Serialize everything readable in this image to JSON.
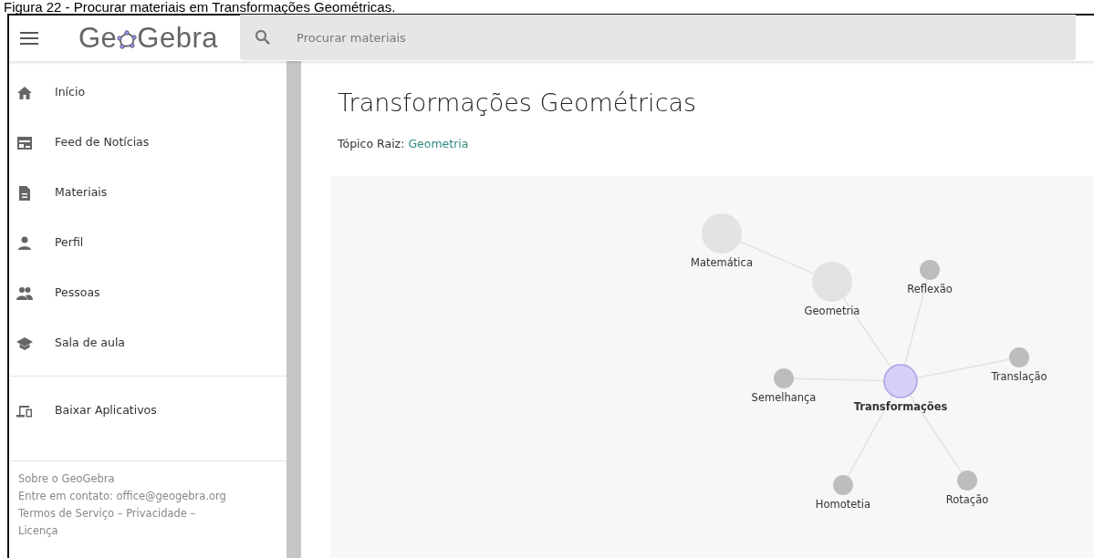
{
  "caption": "Figura 22 - Procurar materiais em Transformações Geométricas.",
  "header": {
    "logo": {
      "before": "Ge",
      "after": "Gebra"
    },
    "search": {
      "placeholder": "Procurar materiais"
    }
  },
  "sidebar": {
    "items": [
      {
        "label": "Início",
        "kind": "home"
      },
      {
        "label": "Feed de Notícias",
        "kind": "feed"
      },
      {
        "label": "Materiais",
        "kind": "document"
      },
      {
        "label": "Perfil",
        "kind": "person"
      },
      {
        "label": "Pessoas",
        "kind": "people"
      },
      {
        "label": "Sala de aula",
        "kind": "school"
      }
    ],
    "apps": {
      "label": "Baixar Aplicativos",
      "kind": "devices"
    },
    "footer": {
      "about": "Sobre o GeoGebra",
      "contact": "Entre em contato: office@geogebra.org",
      "links": [
        "Termos de Serviço",
        "–",
        "Privacidade",
        "–",
        "Licença"
      ]
    }
  },
  "main": {
    "title": "Transformações Geométricas",
    "root_topic": {
      "label": "Tópico Raiz:",
      "link": "Geometria"
    },
    "graph": {
      "label": "Matemática",
      "kind": "ancestor",
      "children": [
        {
          "label": "Geometria",
          "kind": "ancestor",
          "children": [
            {
              "label": "Transformações",
              "kind": "current",
              "children": [
                {
                  "label": "Reflexão",
                  "kind": "child"
                },
                {
                  "label": "Translação",
                  "kind": "child"
                },
                {
                  "label": "Semelhança",
                  "kind": "child"
                },
                {
                  "label": "Homotetia",
                  "kind": "child"
                },
                {
                  "label": "Rotação",
                  "kind": "child"
                }
              ]
            }
          ]
        }
      ]
    }
  }
}
